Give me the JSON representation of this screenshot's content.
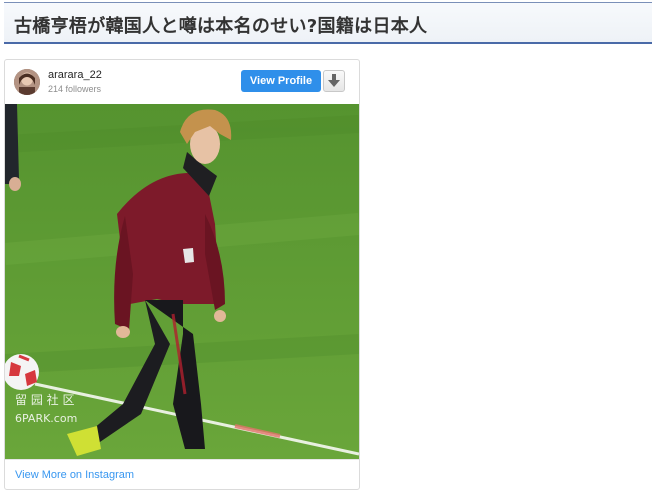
{
  "article": {
    "title": "古橋亨梧が韓国人と噂は本名のせい?国籍は日本人"
  },
  "instagram_embed": {
    "username": "ararara_22",
    "followers": "214 followers",
    "view_profile_label": "View Profile",
    "view_more_label": "View More on Instagram",
    "icons": {
      "download": "download-arrow-icon",
      "avatar": "avatar"
    },
    "colors": {
      "accent": "#2f8fea",
      "link": "#3897f0"
    },
    "photo_watermark": "留园社区 6PARK.com"
  }
}
